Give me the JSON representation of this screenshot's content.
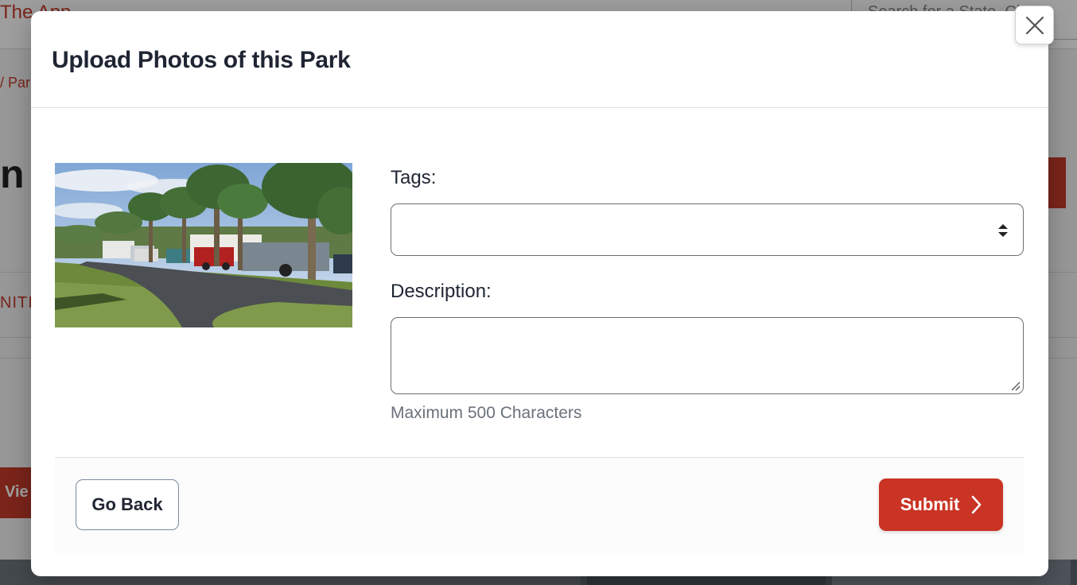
{
  "background": {
    "brand": "The App",
    "search_placeholder": "Search for a State, City, o",
    "breadcrumb": "/ Par",
    "heading_fragment": "n",
    "tab_fragment": "NITI",
    "view_button": "Vie"
  },
  "modal": {
    "title": "Upload Photos of this Park",
    "close_icon": "close-icon",
    "photo_alt": "RV park with palm trees and parked vehicles",
    "tags_label": "Tags:",
    "tags_value": "",
    "description_label": "Description:",
    "description_value": "",
    "description_hint": "Maximum 500 Characters",
    "back_label": "Go Back",
    "submit_label": "Submit",
    "submit_icon": "chevron-right-icon"
  },
  "colors": {
    "accent": "#c93424",
    "title": "#1f2533",
    "hint": "#6a717b"
  }
}
